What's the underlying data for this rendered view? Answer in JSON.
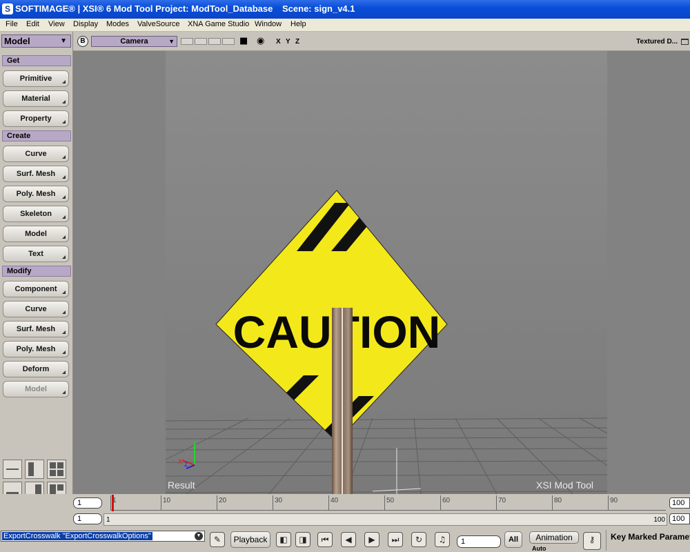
{
  "titlebar": {
    "title": "SOFTIMAGE® | XSI® 6 Mod Tool Project: ModTool_Database",
    "scene": "Scene: sign_v4.1"
  },
  "menu": [
    "File",
    "Edit",
    "View",
    "Display",
    "Modes",
    "ValveSource",
    "XNA Game Studio",
    "Window",
    "Help"
  ],
  "leftpanel": {
    "mode": "Model",
    "sections": {
      "get": "Get",
      "create": "Create",
      "modify": "Modify"
    },
    "get_items": [
      "Primitive",
      "Material",
      "Property"
    ],
    "create_items": [
      "Curve",
      "Surf. Mesh",
      "Poly. Mesh",
      "Skeleton",
      "Model",
      "Text"
    ],
    "modify_items": [
      "Component",
      "Curve",
      "Surf. Mesh",
      "Poly. Mesh",
      "Deform",
      "Model"
    ]
  },
  "viewport": {
    "b_label": "B",
    "camera": "Camera",
    "axes": [
      "X",
      "Y",
      "Z"
    ],
    "shading": "Textured D...",
    "label_left": "Result",
    "label_right": "XSI  Mod  Tool",
    "sign_text": "CAUTION"
  },
  "timeline": {
    "start_field": "1",
    "range_start_field": "1",
    "range_start_label": "1",
    "ruler_numbers": [
      "1",
      "10",
      "20",
      "30",
      "40",
      "50",
      "60",
      "70",
      "80",
      "90"
    ],
    "end_field": "100",
    "range_end_field": "100",
    "range_end_label": "100"
  },
  "bottombar": {
    "command": "ExportCrosswalk \"ExportCrosswalkOptions\"",
    "playback": "Playback",
    "frame": "1",
    "all": "All",
    "animation": "Animation",
    "auto": "Auto",
    "key_panel": "Key Marked Parameters"
  }
}
